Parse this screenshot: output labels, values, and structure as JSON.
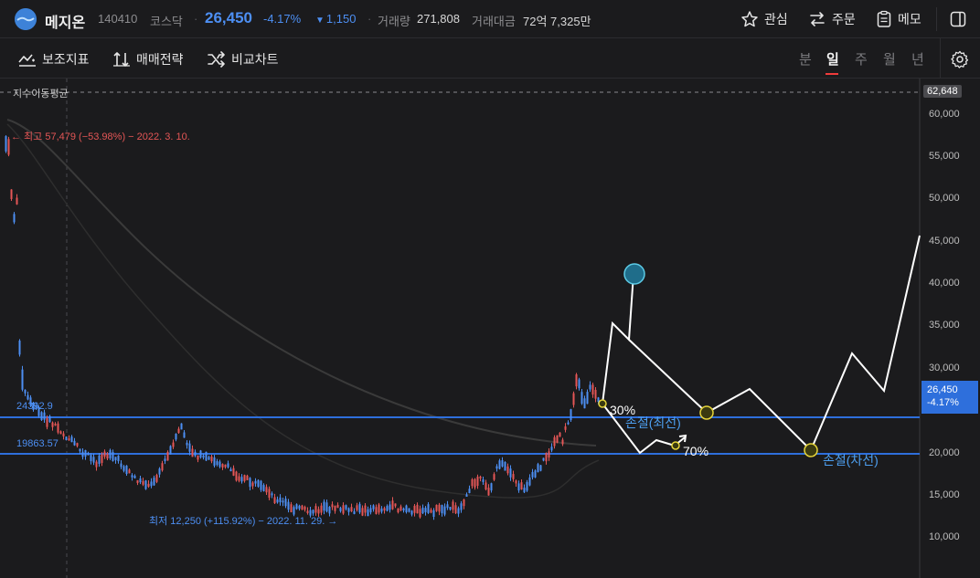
{
  "header": {
    "stock_name": "메지온",
    "stock_code": "140410",
    "market": "코스닥",
    "price": "26,450",
    "change_pct": "-4.17%",
    "change_amt": "1,150",
    "volume_label": "거래량",
    "volume_value": "271,808",
    "amount_label": "거래대금",
    "amount_value": "72억 7,325만",
    "buttons": {
      "watch": "관심",
      "order": "주문",
      "memo": "메모"
    },
    "colors": {
      "down": "#4d8ff3",
      "up": "#e45656"
    }
  },
  "toolbar": {
    "sub_indicator": "보조지표",
    "trade_strategy": "매매전략",
    "compare_chart": "비교차트",
    "periods": [
      "분",
      "일",
      "주",
      "월",
      "년"
    ],
    "active_period": "일"
  },
  "chart": {
    "indicator_label": "지수이동평균",
    "y_axis_top_tag": "62,648",
    "y_ticks": [
      "60,000",
      "55,000",
      "50,000",
      "45,000",
      "40,000",
      "35,000",
      "30,000",
      "25,000",
      "20,000",
      "15,000",
      "10,000"
    ],
    "current_tag_price": "26,450",
    "current_tag_pct": "-4.17%",
    "high_annotation": "← 최고 57,479 (−53.98%) − 2022. 3. 10.",
    "low_annotation": "최저 12,250 (+115.92%) − 2022. 11. 29. →",
    "level_upper": "24392.9",
    "level_lower": "19863.57",
    "drawing_labels": {
      "pct30": "30%",
      "pct70": "70%",
      "stop_first": "손절(최선)",
      "stop_second": "손절(차선)"
    }
  }
}
